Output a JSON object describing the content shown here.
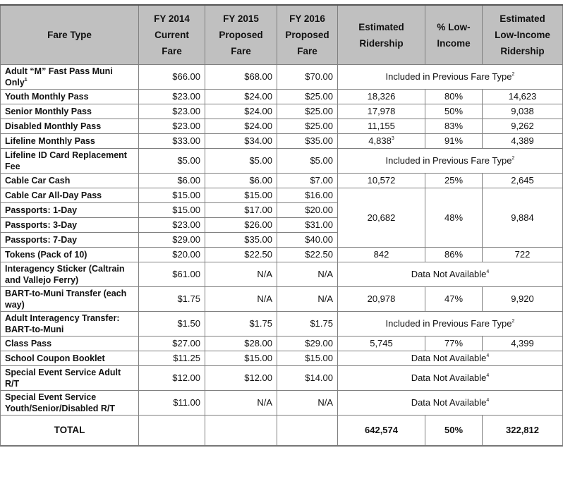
{
  "headers": {
    "fare_type": "Fare Type",
    "fy2014": [
      "FY 2014",
      "Current",
      "Fare"
    ],
    "fy2015": [
      "FY 2015",
      "Proposed",
      "Fare"
    ],
    "fy2016": [
      "FY 2016",
      "Proposed",
      "Fare"
    ],
    "est_ridership": [
      "Estimated",
      "Ridership"
    ],
    "pct_low_income": [
      "% Low-",
      "Income"
    ],
    "est_low_income": [
      "Estimated",
      "Low-Income",
      "Ridership"
    ]
  },
  "notes": {
    "included": "Included in Previous Fare Type",
    "included_sup": "2",
    "dna": "Data Not Available",
    "dna_sup": "4"
  },
  "rows": [
    {
      "fare_type": "Adult “M” Fast Pass Muni Only",
      "sup": "1",
      "fy2014": "$66.00",
      "fy2015": "$68.00",
      "fy2016": "$70.00"
    },
    {
      "fare_type": "Youth Monthly Pass",
      "fy2014": "$23.00",
      "fy2015": "$24.00",
      "fy2016": "$25.00",
      "ridership": "18,326",
      "pct": "80%",
      "low_income": "14,623"
    },
    {
      "fare_type": "Senior Monthly Pass",
      "fy2014": "$23.00",
      "fy2015": "$24.00",
      "fy2016": "$25.00",
      "ridership": "17,978",
      "pct": "50%",
      "low_income": "9,038"
    },
    {
      "fare_type": "Disabled Monthly Pass",
      "fy2014": "$23.00",
      "fy2015": "$24.00",
      "fy2016": "$25.00",
      "ridership": "11,155",
      "pct": "83%",
      "low_income": "9,262"
    },
    {
      "fare_type": "Lifeline Monthly Pass",
      "fy2014": "$33.00",
      "fy2015": "$34.00",
      "fy2016": "$35.00",
      "ridership": "4,838",
      "ridership_sup": "3",
      "pct": "91%",
      "low_income": "4,389"
    },
    {
      "fare_type": "Lifeline ID Card Replacement Fee",
      "fy2014": "$5.00",
      "fy2015": "$5.00",
      "fy2016": "$5.00"
    },
    {
      "fare_type": "Cable Car Cash",
      "fy2014": "$6.00",
      "fy2015": "$6.00",
      "fy2016": "$7.00",
      "ridership": "10,572",
      "pct": "25%",
      "low_income": "2,645"
    },
    {
      "fare_type": "Cable Car All-Day Pass",
      "fy2014": "$15.00",
      "fy2015": "$15.00",
      "fy2016": "$16.00",
      "ridership": "20,682",
      "pct": "48%",
      "low_income": "9,884"
    },
    {
      "fare_type": "Passports: 1-Day",
      "fy2014": "$15.00",
      "fy2015": "$17.00",
      "fy2016": "$20.00"
    },
    {
      "fare_type": "Passports: 3-Day",
      "fy2014": "$23.00",
      "fy2015": "$26.00",
      "fy2016": "$31.00"
    },
    {
      "fare_type": "Passports: 7-Day",
      "fy2014": "$29.00",
      "fy2015": "$35.00",
      "fy2016": "$40.00"
    },
    {
      "fare_type": "Tokens (Pack of 10)",
      "fy2014": "$20.00",
      "fy2015": "$22.50",
      "fy2016": "$22.50",
      "ridership": "842",
      "pct": "86%",
      "low_income": "722"
    },
    {
      "fare_type": "Interagency Sticker (Caltrain and Vallejo Ferry)",
      "fy2014": "$61.00",
      "fy2015": "N/A",
      "fy2016": "N/A"
    },
    {
      "fare_type": "BART-to-Muni Transfer (each way)",
      "fy2014": "$1.75",
      "fy2015": "N/A",
      "fy2016": "N/A",
      "ridership": "20,978",
      "pct": "47%",
      "low_income": "9,920"
    },
    {
      "fare_type": "Adult Interagency Transfer: BART-to-Muni",
      "fy2014": "$1.50",
      "fy2015": "$1.75",
      "fy2016": "$1.75"
    },
    {
      "fare_type": "Class Pass",
      "fy2014": "$27.00",
      "fy2015": "$28.00",
      "fy2016": "$29.00",
      "ridership": "5,745",
      "pct": "77%",
      "low_income": "4,399"
    },
    {
      "fare_type": "School Coupon Booklet",
      "fy2014": "$11.25",
      "fy2015": "$15.00",
      "fy2016": "$15.00"
    },
    {
      "fare_type": "Special Event Service Adult R/T",
      "fy2014": "$12.00",
      "fy2015": "$12.00",
      "fy2016": "$14.00"
    },
    {
      "fare_type": "Special Event Service Youth/Senior/Disabled R/T",
      "fy2014": "$11.00",
      "fy2015": "N/A",
      "fy2016": "N/A"
    }
  ],
  "total": {
    "label": "TOTAL",
    "ridership": "642,574",
    "pct": "50%",
    "low_income": "322,812"
  }
}
